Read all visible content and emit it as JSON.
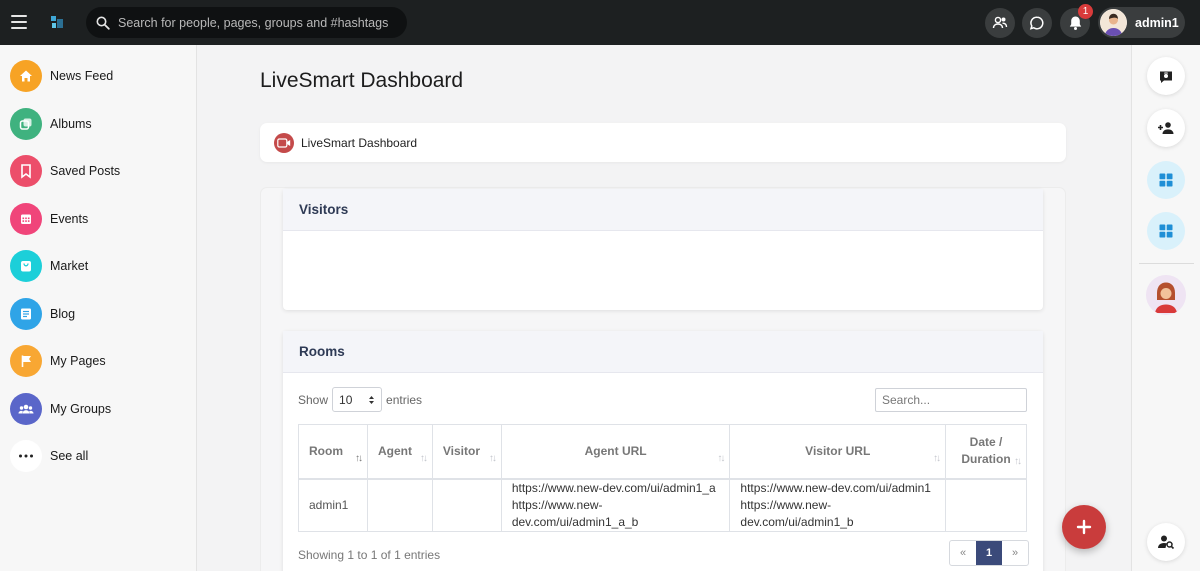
{
  "topbar": {
    "search_placeholder": "Search for people, pages, groups and #hashtags",
    "notification_count": "1",
    "username": "admin1"
  },
  "sidebar": {
    "items": [
      {
        "label": "News Feed",
        "icon": "home-icon",
        "color": "#f7a325"
      },
      {
        "label": "Albums",
        "icon": "albums-icon",
        "color": "#3fb27f"
      },
      {
        "label": "Saved Posts",
        "icon": "bookmark-icon",
        "color": "#ec4e6a"
      },
      {
        "label": "Events",
        "icon": "calendar-icon",
        "color": "#f0457a"
      },
      {
        "label": "Market",
        "icon": "shopping-bag-icon",
        "color": "#1ccfd9"
      },
      {
        "label": "Blog",
        "icon": "blog-icon",
        "color": "#2fa4e7"
      },
      {
        "label": "My Pages",
        "icon": "flag-icon",
        "color": "#f8a733"
      },
      {
        "label": "My Groups",
        "icon": "groups-icon",
        "color": "#5a66c9"
      },
      {
        "label": "See all",
        "icon": "more-icon",
        "color": "#ffffff"
      }
    ]
  },
  "main": {
    "title": "LiveSmart Dashboard",
    "breadcrumb_label": "LiveSmart Dashboard",
    "visitors_title": "Visitors",
    "rooms_title": "Rooms",
    "show_label": "Show",
    "entries_label": "entries",
    "page_size": "10",
    "table_search_placeholder": "Search...",
    "columns": [
      "Room",
      "Agent",
      "Visitor",
      "Agent URL",
      "Visitor URL",
      "Date /",
      "Duration"
    ],
    "rows": [
      {
        "room": "admin1",
        "agent": "",
        "visitor": "",
        "agent_url_1": "https://www.new-dev.com/ui/admin1_a",
        "agent_url_2": "https://www.new-dev.com/ui/admin1_a_b",
        "visitor_url_1": "https://www.new-dev.com/ui/admin1",
        "visitor_url_2": "https://www.new-dev.com/ui/admin1_b",
        "date_duration": ""
      }
    ],
    "info": "Showing 1 to 1 of 1 entries",
    "pagination": {
      "prev": "«",
      "current": "1",
      "next": "»"
    }
  },
  "colors": {
    "topbar": "#1d2021",
    "accent": "#3b4a7a",
    "fab": "#c93c3c"
  }
}
